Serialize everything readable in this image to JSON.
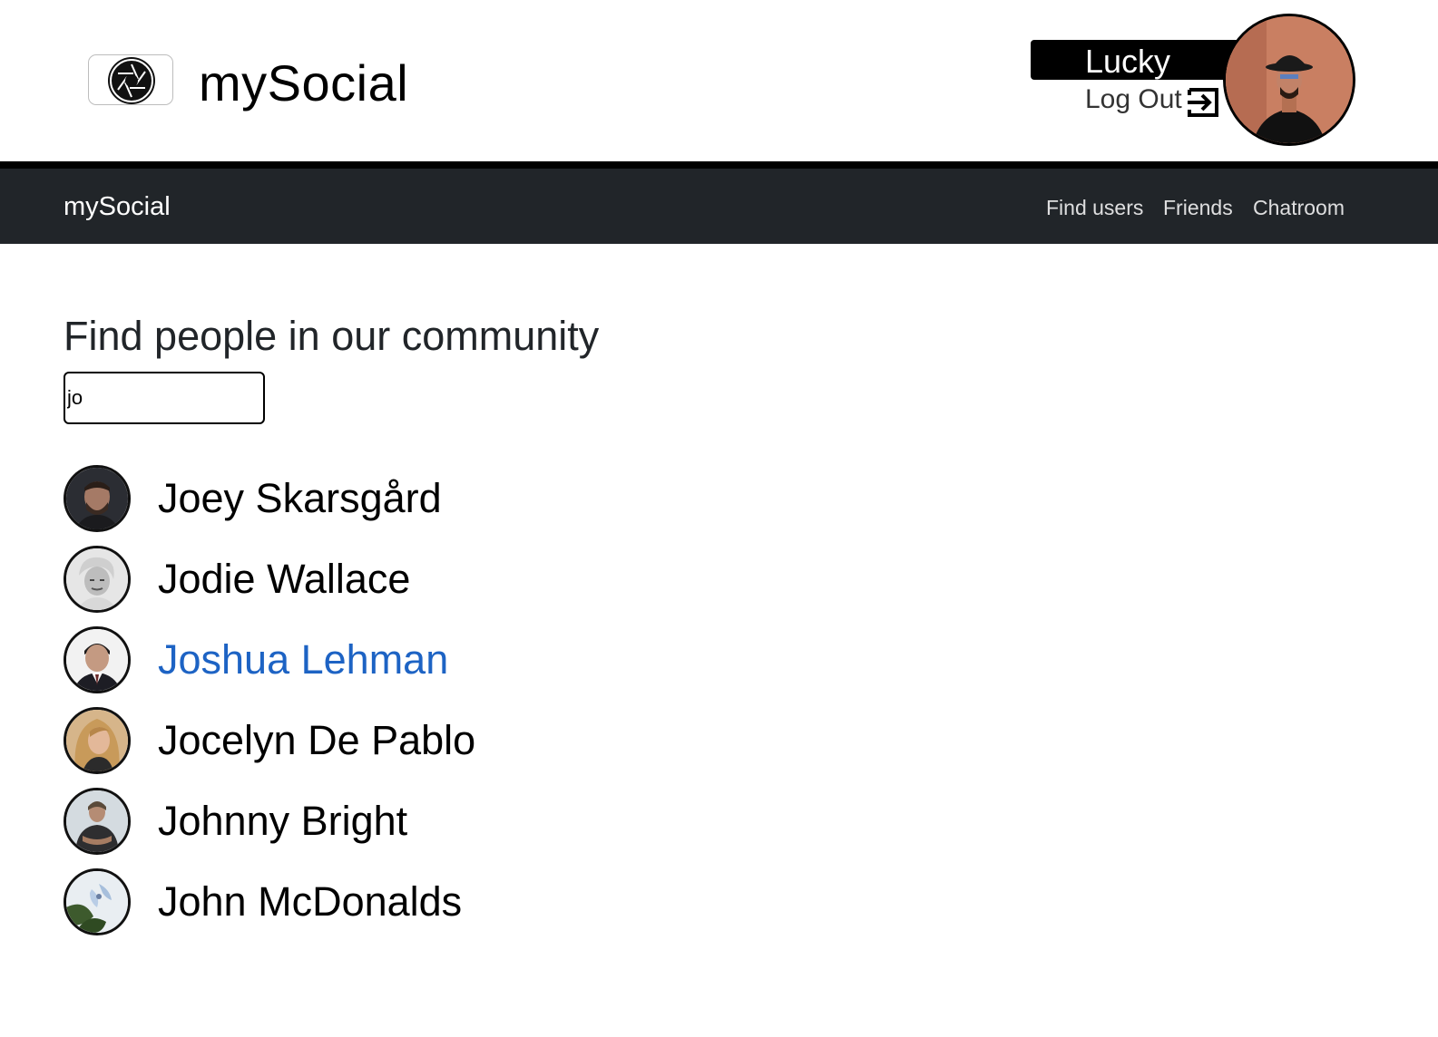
{
  "brand": {
    "title": "mySocial",
    "logo_icon": "camera-shutter-icon"
  },
  "current_user": {
    "name": "Lucky",
    "logout_label": "Log Out",
    "logout_icon": "logout-icon",
    "avatar_icon": "avatar"
  },
  "navbar": {
    "brand": "mySocial",
    "links": [
      {
        "label": "Find users"
      },
      {
        "label": "Friends"
      },
      {
        "label": "Chatroom"
      }
    ],
    "background": "#212529"
  },
  "main": {
    "title": "Find people in our community",
    "search": {
      "value": "jo",
      "placeholder": ""
    }
  },
  "users": [
    {
      "name": "Joey Skarsgård",
      "highlighted": false
    },
    {
      "name": "Jodie Wallace",
      "highlighted": false
    },
    {
      "name": "Joshua Lehman",
      "highlighted": true
    },
    {
      "name": "Jocelyn De Pablo",
      "highlighted": false
    },
    {
      "name": "Johnny Bright",
      "highlighted": false
    },
    {
      "name": "John McDonalds",
      "highlighted": false
    }
  ],
  "colors": {
    "link": "#1d63c4",
    "text": "#000000",
    "banner": "#000000"
  }
}
